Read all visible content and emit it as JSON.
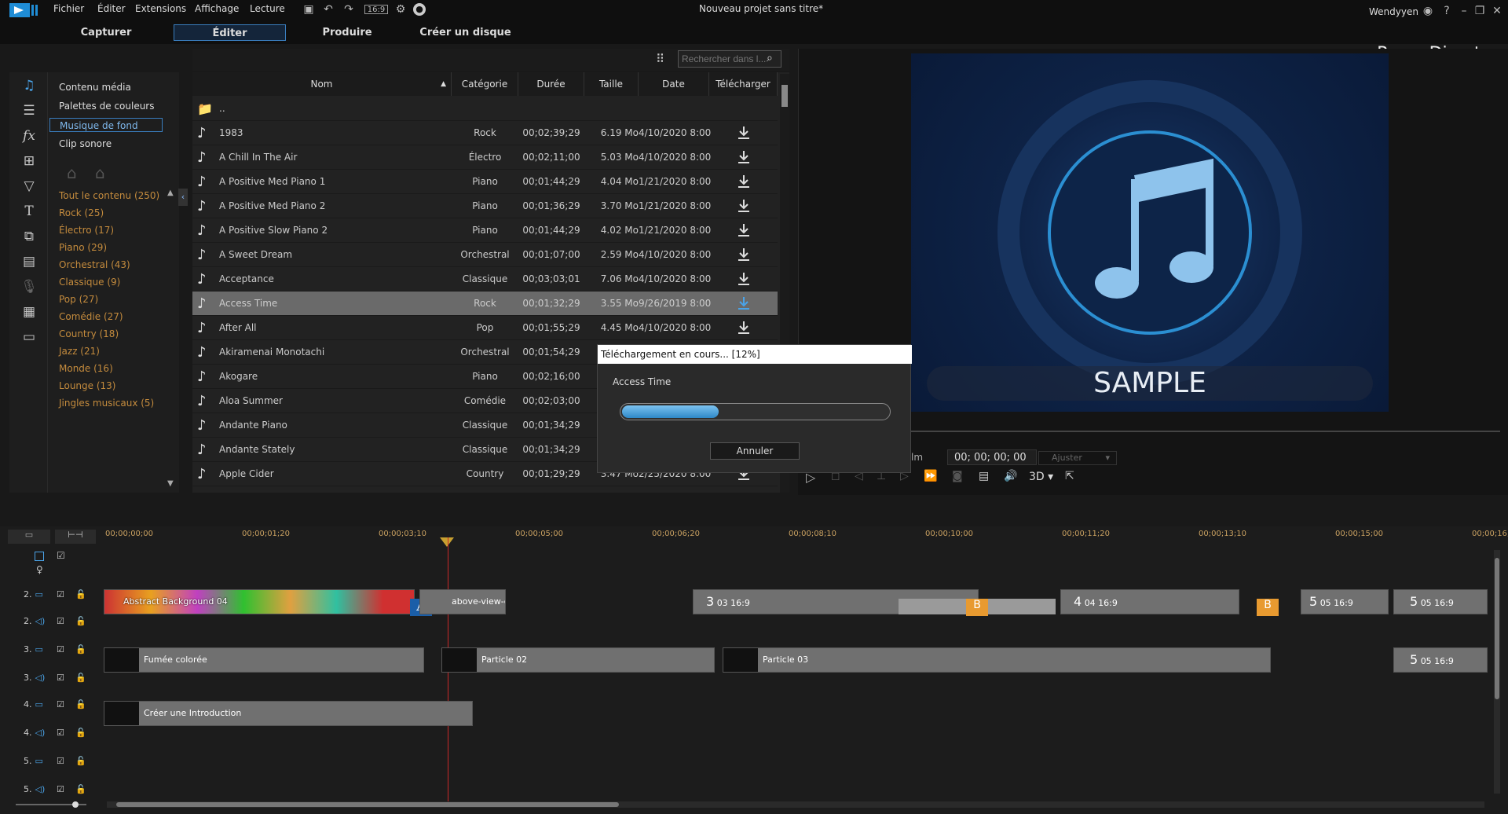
{
  "app": {
    "title": "Nouveau projet sans titre*",
    "brand": "PowerDirector",
    "user": "Wendyyen"
  },
  "menu": [
    "Fichier",
    "Éditer",
    "Extensions",
    "Affichage",
    "Lecture"
  ],
  "aspect_label": "16:9",
  "modes": [
    "Capturer",
    "Éditer",
    "Produire",
    "Créer un disque"
  ],
  "library": {
    "nav": [
      "Contenu média",
      "Palettes de couleurs",
      "Musique de fond",
      "Clip sonore"
    ],
    "tags": [
      "Tout le contenu  (250)",
      "Rock  (25)",
      "Électro  (17)",
      "Piano  (29)",
      "Orchestral  (43)",
      "Classique  (9)",
      "Pop  (27)",
      "Comédie  (27)",
      "Country  (18)",
      "Jazz  (21)",
      "Monde  (16)",
      "Lounge  (13)",
      "Jingles musicaux  (5)"
    ],
    "search_placeholder": "Rechercher dans l..."
  },
  "table": {
    "headers": [
      "Nom",
      "Catégorie",
      "Durée",
      "Taille",
      "Date",
      "Télécharger"
    ],
    "up_label": "..",
    "rows": [
      [
        "1983",
        "Rock",
        "00;02;39;29",
        "6.19 Mo",
        "4/10/2020 8:00:0..."
      ],
      [
        "A Chill In The Air",
        "Électro",
        "00;02;11;00",
        "5.03 Mo",
        "4/10/2020 8:00:0..."
      ],
      [
        "A Positive Med Piano 1",
        "Piano",
        "00;01;44;29",
        "4.04 Mo",
        "1/21/2020 8:00:0..."
      ],
      [
        "A Positive Med Piano 2",
        "Piano",
        "00;01;36;29",
        "3.70 Mo",
        "1/21/2020 8:00:0..."
      ],
      [
        "A Positive Slow Piano 2",
        "Piano",
        "00;01;44;29",
        "4.02 Mo",
        "1/21/2020 8:00:0..."
      ],
      [
        "A Sweet Dream",
        "Orchestral",
        "00;01;07;00",
        "2.59 Mo",
        "4/10/2020 8:00:0..."
      ],
      [
        "Acceptance",
        "Classique",
        "00;03;03;01",
        "7.06 Mo",
        "4/10/2020 8:00:0..."
      ],
      [
        "Access Time",
        "Rock",
        "00;01;32;29",
        "3.55 Mo",
        "9/26/2019 8:00:0..."
      ],
      [
        "After All",
        "Pop",
        "00;01;55;29",
        "4.45 Mo",
        "4/10/2020 8:00:0..."
      ],
      [
        "Akiramenai Monotachi",
        "Orchestral",
        "00;01;54;29",
        "",
        ""
      ],
      [
        "Akogare",
        "Piano",
        "00;02;16;00",
        "",
        ""
      ],
      [
        "Aloa Summer",
        "Comédie",
        "00;02;03;00",
        "",
        ""
      ],
      [
        "Andante Piano",
        "Classique",
        "00;01;34;29",
        "",
        ""
      ],
      [
        "Andante Stately",
        "Classique",
        "00;01;34;29",
        "",
        ""
      ],
      [
        "Apple Cider",
        "Country",
        "00;01;29;29",
        "3.47 Mo",
        "2/25/2020 8:00:0..."
      ]
    ]
  },
  "dialog": {
    "title": "Téléchargement en cours... [12%]",
    "file": "Access Time",
    "progress": 0.12,
    "cancel": "Annuler"
  },
  "preview": {
    "watermark": "SAMPLE",
    "mode_label": "lm",
    "timecode": "00; 00; 00; 00",
    "fit": "Ajuster",
    "stereo": "3D"
  },
  "timeline": {
    "ticks": [
      "00;00;00;00",
      "00;00;01;20",
      "00;00;03;10",
      "00;00;05;00",
      "00;00;06;20",
      "00;00;08;10",
      "00;00;10;00",
      "00;00;11;20",
      "00;00;13;10",
      "00;00;15;00",
      "00;00;16;20"
    ],
    "tracks": [
      "2.",
      "2.",
      "3.",
      "3.",
      "4.",
      "4.",
      "5.",
      "5."
    ],
    "clips": {
      "abstract": "Abstract Background 04",
      "above": "above-view-c",
      "smoke": "Fumée colorée",
      "p2": "Particle 02",
      "p3": "Particle 03",
      "intro": "Créer une Introduction",
      "c3": "03 16:9",
      "c4": "04 16:9",
      "c5": "05 16:9",
      "n3": "3",
      "n4": "4",
      "n5": "5"
    }
  }
}
